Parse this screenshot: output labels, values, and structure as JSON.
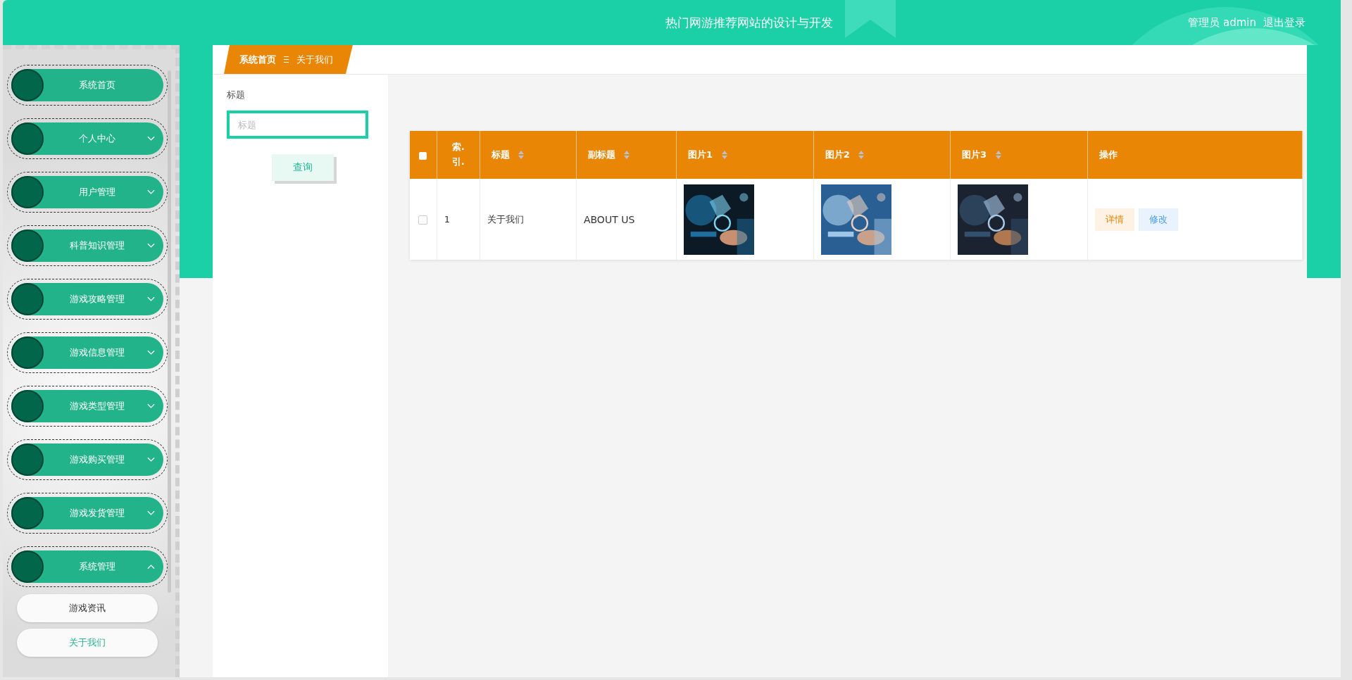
{
  "header": {
    "title": "热门网游推荐网站的设计与开发",
    "user": "管理员 admin",
    "logout": "退出登录"
  },
  "sidebar": {
    "items": [
      {
        "label": "系统首页",
        "kind": "link"
      },
      {
        "label": "个人中心",
        "kind": "group",
        "expanded": false
      },
      {
        "label": "用户管理",
        "kind": "group",
        "expanded": false
      },
      {
        "label": "科普知识管理",
        "kind": "group",
        "expanded": false
      },
      {
        "label": "游戏攻略管理",
        "kind": "group",
        "expanded": false
      },
      {
        "label": "游戏信息管理",
        "kind": "group",
        "expanded": false
      },
      {
        "label": "游戏类型管理",
        "kind": "group",
        "expanded": false
      },
      {
        "label": "游戏购买管理",
        "kind": "group",
        "expanded": false
      },
      {
        "label": "游戏发货管理",
        "kind": "group",
        "expanded": false
      },
      {
        "label": "系统管理",
        "kind": "group",
        "expanded": true,
        "children": [
          {
            "label": "游戏资讯",
            "selected": false
          },
          {
            "label": "关于我们",
            "selected": true
          }
        ]
      }
    ]
  },
  "breadcrumb": [
    "系统首页",
    "关于我们"
  ],
  "search": {
    "label": "标题",
    "placeholder": "标题",
    "button": "查询"
  },
  "table": {
    "select_all_checked": false,
    "columns": [
      {
        "label": "索.引.",
        "sortable": false
      },
      {
        "label": "标题",
        "sortable": true
      },
      {
        "label": "副标题",
        "sortable": true
      },
      {
        "label": "图片1",
        "sortable": true
      },
      {
        "label": "图片2",
        "sortable": true
      },
      {
        "label": "图片3",
        "sortable": true
      },
      {
        "label": "操作",
        "sortable": false
      }
    ],
    "rows": [
      {
        "checked": false,
        "index": "1",
        "title": "关于我们",
        "subtitle": "ABOUT US",
        "images": [
          {
            "kind": "picture"
          },
          {
            "kind": "picture"
          },
          {
            "kind": "picture"
          }
        ],
        "actions": [
          {
            "kind": "detail",
            "label": "详情"
          },
          {
            "kind": "edit",
            "label": "修改"
          }
        ]
      }
    ]
  }
}
